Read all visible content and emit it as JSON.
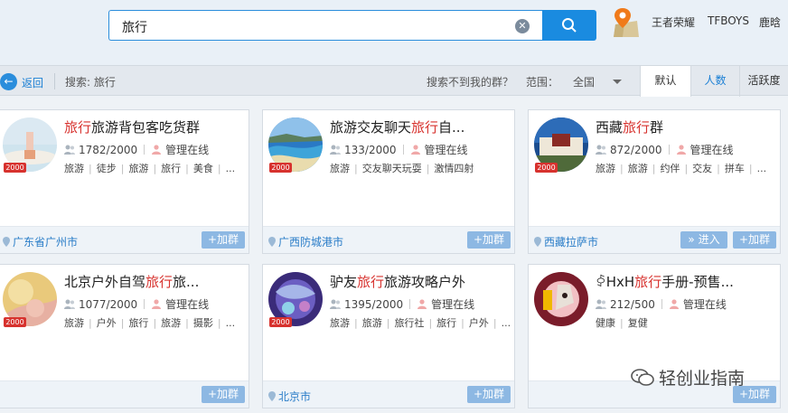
{
  "search": {
    "query": "旅行",
    "clear_icon": "clear-icon",
    "search_icon": "search-icon"
  },
  "hot_links": [
    "王者荣耀",
    "TFBOYS",
    "鹿晗"
  ],
  "filter": {
    "back_label": "返回",
    "search_info": "搜索: 旅行",
    "not_found": "搜索不到我的群？",
    "range_label": "范围：",
    "range_value": "全国",
    "tabs": [
      "默认",
      "人数",
      "活跃度"
    ]
  },
  "cards": [
    {
      "name_hl": "旅行",
      "name_rest": "旅游背包客吃货群",
      "name_pre": "",
      "members": "1782/2000",
      "admin": "管理在线",
      "tags": [
        "旅游",
        "徒步",
        "旅游",
        "旅行",
        "美食",
        "..."
      ],
      "badge": "2000",
      "location": "广东省广州市",
      "join": "+加群",
      "enter": ""
    },
    {
      "name_pre": "旅游交友聊天",
      "name_hl": "旅行",
      "name_rest": "自...",
      "members": "133/2000",
      "admin": "管理在线",
      "tags": [
        "旅游",
        "交友聊天玩耍",
        "激情四射"
      ],
      "badge": "2000",
      "location": "广西防城港市",
      "join": "+加群",
      "enter": ""
    },
    {
      "name_pre": "西藏",
      "name_hl": "旅行",
      "name_rest": "群",
      "members": "872/2000",
      "admin": "管理在线",
      "tags": [
        "旅游",
        "旅游",
        "约伴",
        "交友",
        "拼车",
        "..."
      ],
      "badge": "2000",
      "location": "西藏拉萨市",
      "join": "+加群",
      "enter": "» 进入"
    },
    {
      "name_pre": "北京户外自驾",
      "name_hl": "旅行",
      "name_rest": "旅...",
      "members": "1077/2000",
      "admin": "管理在线",
      "tags": [
        "旅游",
        "户外",
        "旅行",
        "旅游",
        "摄影",
        "..."
      ],
      "badge": "2000",
      "location": "",
      "join": "+加群",
      "enter": ""
    },
    {
      "name_pre": "驴友",
      "name_hl": "旅行",
      "name_rest": "旅游攻略户外",
      "members": "1395/2000",
      "admin": "管理在线",
      "tags": [
        "旅游",
        "旅游",
        "旅行社",
        "旅行",
        "户外",
        "..."
      ],
      "badge": "2000",
      "location": "北京市",
      "join": "+加群",
      "enter": ""
    },
    {
      "name_pre": "ꀆHxH",
      "name_hl": "旅行",
      "name_rest": "手册-预售...",
      "members": "212/500",
      "admin": "管理在线",
      "tags": [
        "健康",
        "复健"
      ],
      "badge": "",
      "location": "",
      "join": "+加群",
      "enter": ""
    }
  ],
  "watermark": "轻创业指南",
  "colors": {
    "accent": "#1a8be0",
    "highlight": "#d7322e",
    "join_button": "#8db8e3"
  }
}
